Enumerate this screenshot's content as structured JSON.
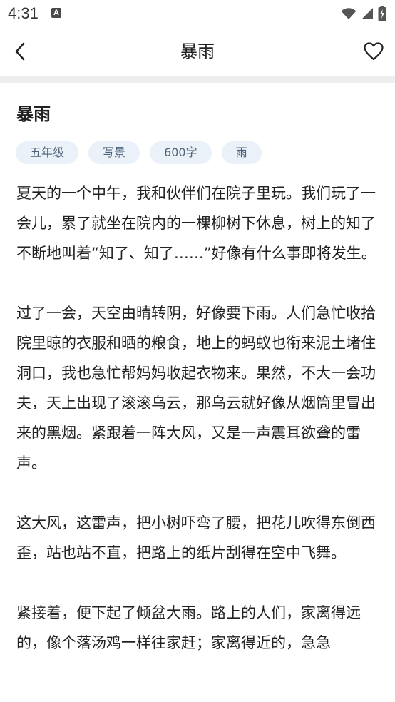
{
  "status_bar": {
    "time": "4:31",
    "notification_icon": "a-icon",
    "wifi_icon": "wifi-icon",
    "signal_icon": "signal-icon",
    "battery_icon": "battery-charging-icon"
  },
  "header": {
    "title": "暴雨",
    "back_icon": "chevron-left-icon",
    "favorite_icon": "heart-outline-icon"
  },
  "article": {
    "title": "暴雨",
    "tags": [
      "五年级",
      "写景",
      "600字",
      "雨"
    ],
    "paragraphs": [
      "夏天的一个中午，我和伙伴们在院子里玩。我们玩了一会儿，累了就坐在院内的一棵柳树下休息，树上的知了不断地叫着“知了、知了……”好像有什么事即将发生。",
      "过了一会，天空由晴转阴，好像要下雨。人们急忙收拾院里晾的衣服和晒的粮食，地上的蚂蚁也衔来泥土堵住洞口，我也急忙帮妈妈收起衣物来。果然，不大一会功夫，天上出现了滚滚乌云，那乌云就好像从烟筒里冒出来的黑烟。紧跟着一阵大风，又是一声震耳欲聋的雷声。",
      "这大风，这雷声，把小树吓弯了腰，把花儿吹得东倒西歪，站也站不直，把路上的纸片刮得在空中飞舞。",
      "紧接着，便下起了倾盆大雨。路上的人们，家离得远的，像个落汤鸡一样往家赶；家离得近的，急急"
    ]
  }
}
